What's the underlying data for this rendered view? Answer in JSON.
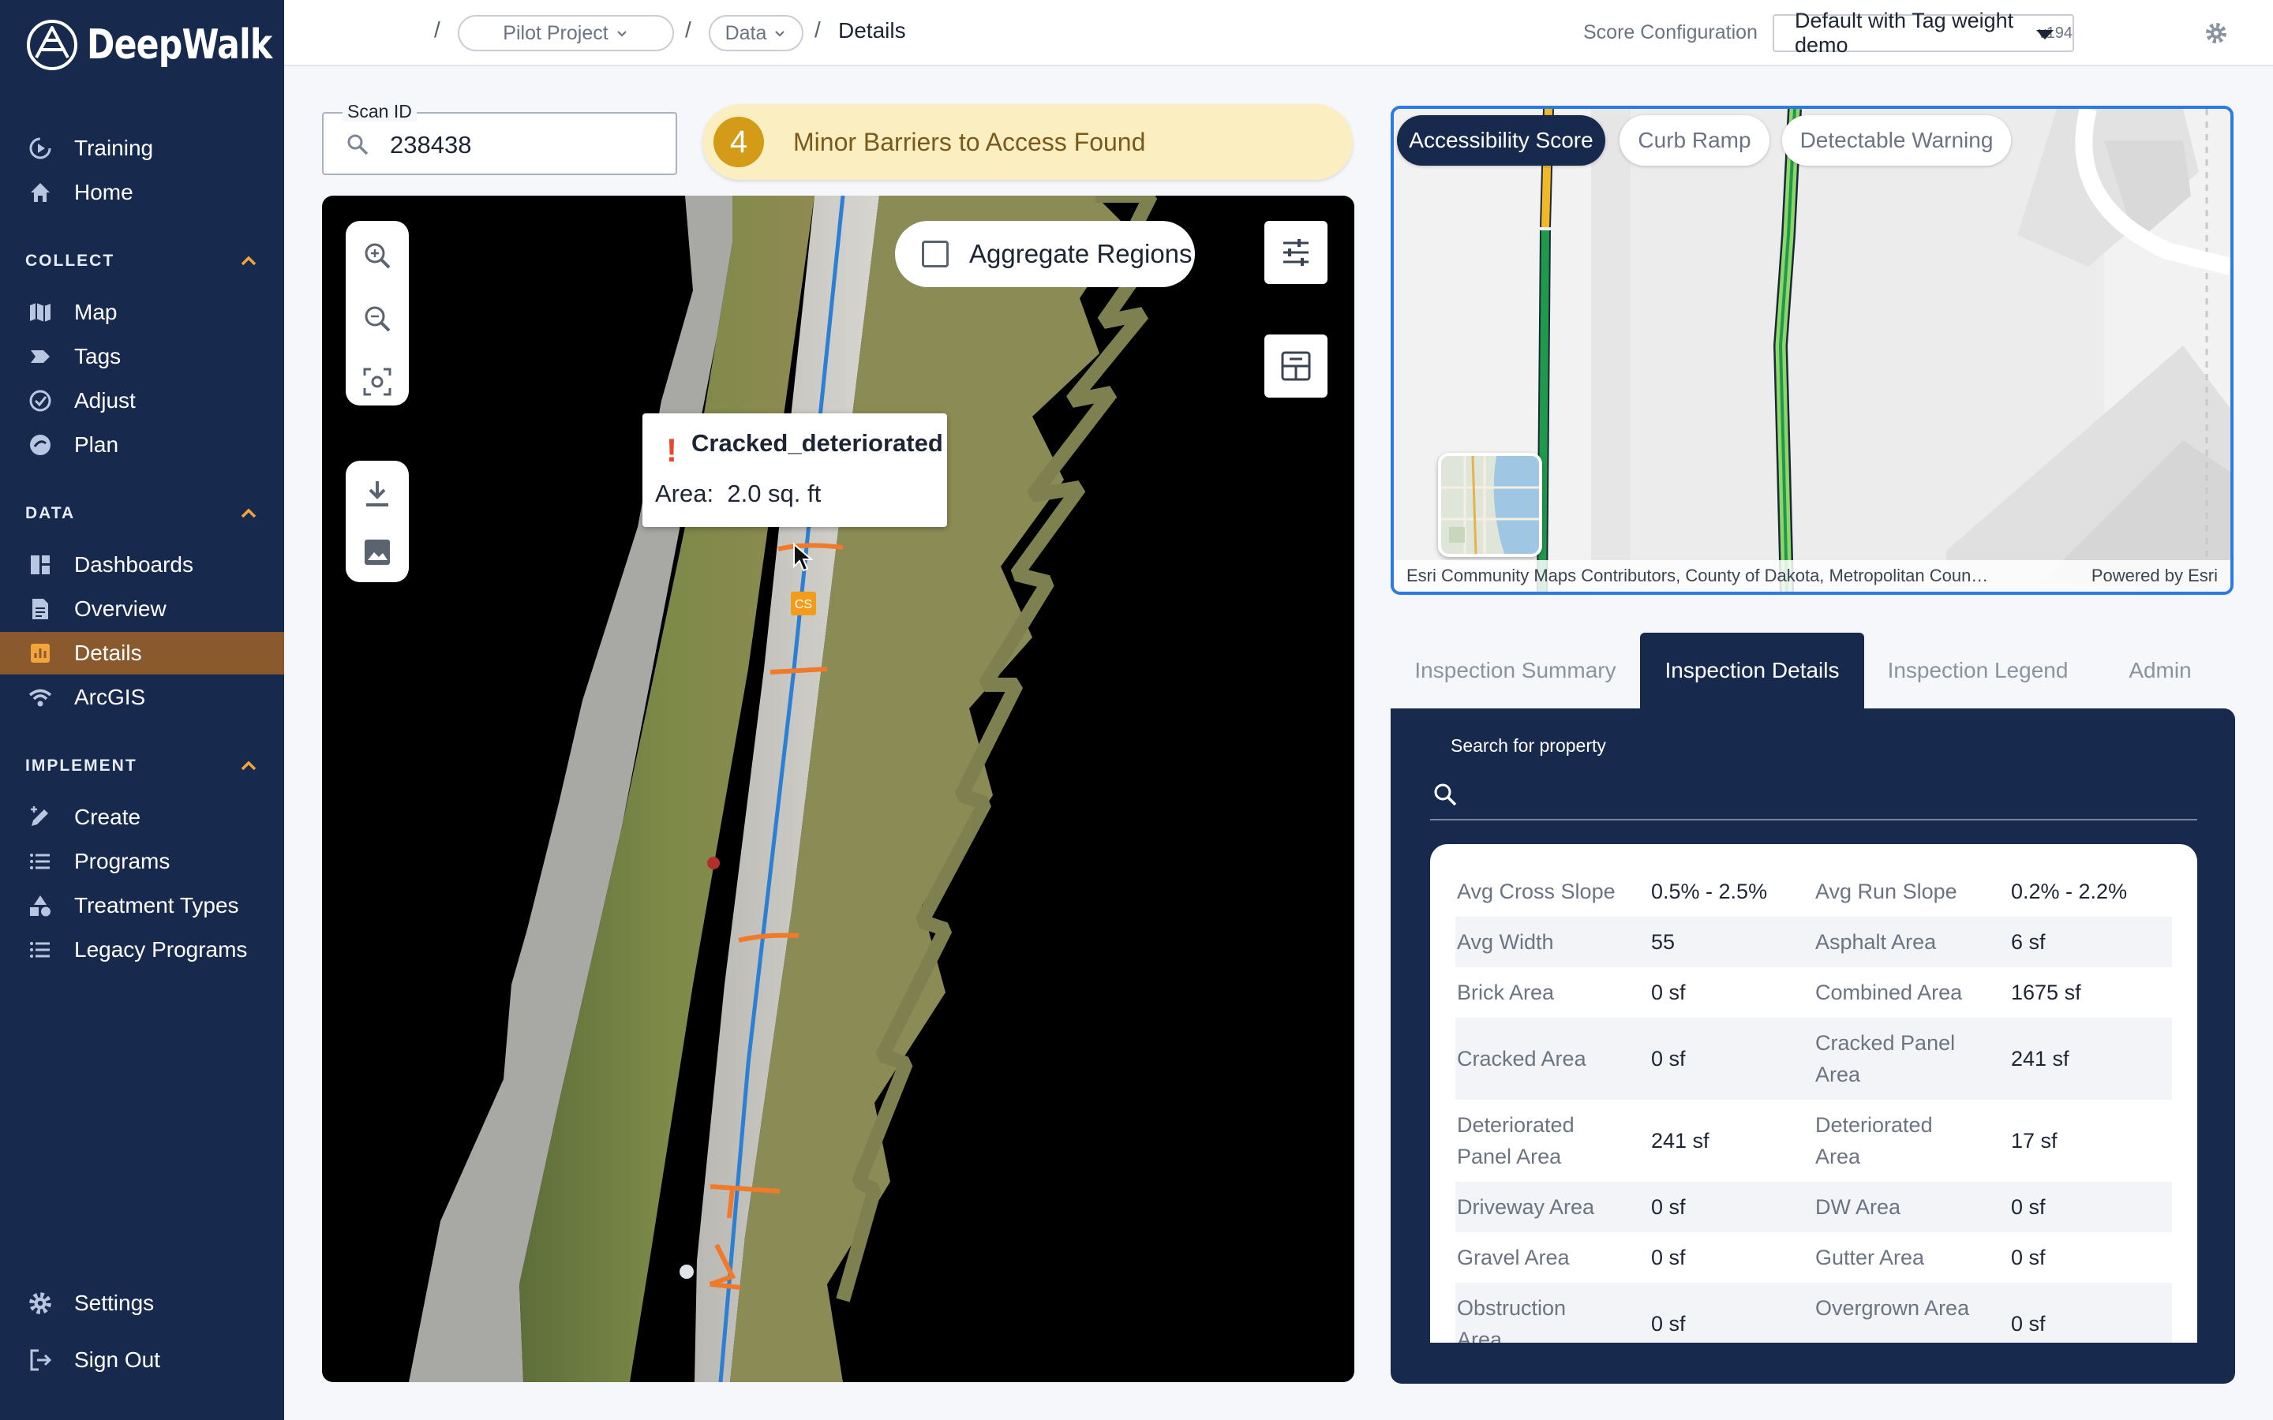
{
  "app": {
    "name": "DeepWalk"
  },
  "sidebar": {
    "top_items": [
      {
        "label": "Training",
        "icon": "training-icon"
      },
      {
        "label": "Home",
        "icon": "home-icon"
      }
    ],
    "sections": [
      {
        "title": "COLLECT",
        "items": [
          {
            "label": "Map",
            "icon": "map-icon"
          },
          {
            "label": "Tags",
            "icon": "tag-icon"
          },
          {
            "label": "Adjust",
            "icon": "adjust-icon"
          },
          {
            "label": "Plan",
            "icon": "plan-icon"
          }
        ]
      },
      {
        "title": "DATA",
        "items": [
          {
            "label": "Dashboards",
            "icon": "dashboard-icon"
          },
          {
            "label": "Overview",
            "icon": "overview-icon"
          },
          {
            "label": "Details",
            "icon": "details-icon"
          },
          {
            "label": "ArcGIS",
            "icon": "arcgis-icon"
          }
        ]
      },
      {
        "title": "IMPLEMENT",
        "items": [
          {
            "label": "Create",
            "icon": "create-icon"
          },
          {
            "label": "Programs",
            "icon": "list-icon"
          },
          {
            "label": "Treatment Types",
            "icon": "shapes-icon"
          },
          {
            "label": "Legacy Programs",
            "icon": "list-icon"
          }
        ]
      }
    ],
    "footer": [
      {
        "label": "Settings",
        "icon": "gear-icon"
      },
      {
        "label": "Sign Out",
        "icon": "sign-out-icon"
      }
    ],
    "active_item": "Details",
    "colors": {
      "bg": "#172a4d",
      "active_bg": "#8a5a2e",
      "accent": "#f2a53a"
    }
  },
  "breadcrumb": {
    "sep": "/",
    "project": "Pilot Project",
    "data": "Data",
    "current": "Details"
  },
  "score_config": {
    "label": "Score Configuration",
    "value": "Default with Tag weight demo",
    "version": "v194"
  },
  "scan": {
    "label": "Scan ID",
    "value": "238438"
  },
  "banner": {
    "count": "4",
    "text": "Minor Barriers to Access Found"
  },
  "viewer": {
    "aggregate_label": "Aggregate Regions",
    "tooltip": {
      "title": "Cracked_deteriorated",
      "area_label": "Area:",
      "area_value": "2.0 sq. ft"
    },
    "marker_label": "CS"
  },
  "map": {
    "layers": [
      {
        "label": "Accessibility Score",
        "active": true
      },
      {
        "label": "Curb Ramp",
        "active": false
      },
      {
        "label": "Detectable Warning",
        "active": false
      }
    ],
    "attribution": "Esri Community Maps Contributors, County of Dakota, Metropolitan Coun…",
    "powered": "Powered by Esri"
  },
  "tabs": [
    {
      "label": "Inspection Summary",
      "active": false
    },
    {
      "label": "Inspection Details",
      "active": true
    },
    {
      "label": "Inspection Legend",
      "active": false
    },
    {
      "label": "Admin",
      "active": false
    }
  ],
  "details": {
    "search_label": "Search for property",
    "rows": [
      {
        "k1": "Avg Cross Slope",
        "v1": "0.5% - 2.5%",
        "k2": "Avg Run Slope",
        "v2": "0.2% - 2.2%"
      },
      {
        "k1": "Avg Width",
        "v1": "55",
        "k2": "Asphalt Area",
        "v2": "6 sf"
      },
      {
        "k1": "Brick Area",
        "v1": "0 sf",
        "k2": "Combined Area",
        "v2": "1675 sf"
      },
      {
        "k1": "Cracked Area",
        "v1": "0 sf",
        "k2": "Cracked Panel Area",
        "v2": "241 sf"
      },
      {
        "k1": "Deteriorated Panel Area",
        "v1": "241 sf",
        "k2": "Deteriorated Area",
        "v2": "17 sf"
      },
      {
        "k1": "Driveway Area",
        "v1": "0 sf",
        "k2": "DW Area",
        "v2": "0 sf"
      },
      {
        "k1": "Gravel Area",
        "v1": "0 sf",
        "k2": "Gutter Area",
        "v2": "0 sf"
      },
      {
        "k1": "Obstruction Area",
        "v1": "0 sf",
        "k2": "Overgrown Area",
        "v2": "0 sf"
      }
    ]
  }
}
